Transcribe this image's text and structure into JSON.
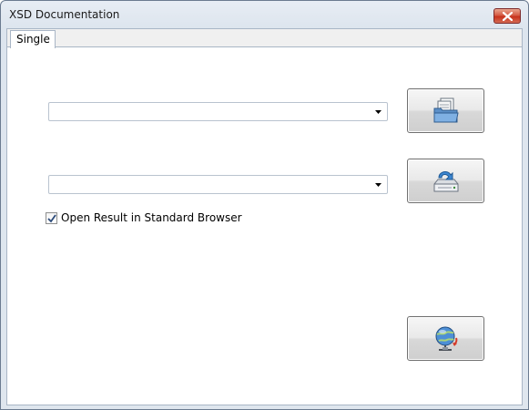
{
  "window": {
    "title": "XSD Documentation"
  },
  "tabs": [
    {
      "label": "Single",
      "selected": true
    }
  ],
  "form": {
    "source_combo": {
      "value": ""
    },
    "target_combo": {
      "value": ""
    },
    "open_in_browser": {
      "label": "Open Result in Standard Browser",
      "checked": true
    }
  },
  "buttons": {
    "open_icon": "open-folder-icon",
    "save_icon": "save-drive-icon",
    "browser_icon": "globe-network-icon"
  },
  "colors": {
    "close_button": "#c8321c",
    "client_background": "#ffffff",
    "window_frame": "#dde5ee"
  }
}
